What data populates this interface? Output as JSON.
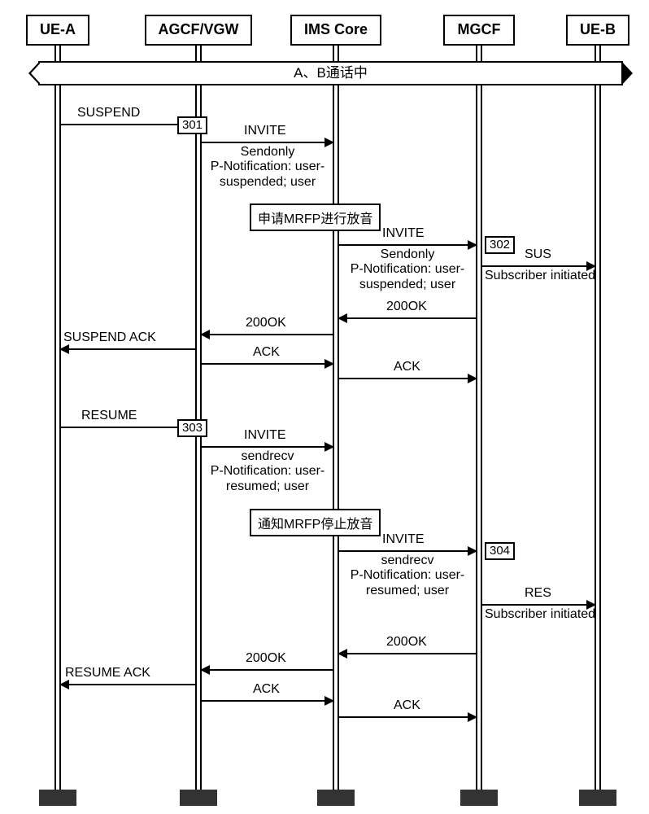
{
  "participants": {
    "uea": "UE-A",
    "agcf": "AGCF/VGW",
    "ims": "IMS Core",
    "mgcf": "MGCF",
    "ueb": "UE-B"
  },
  "state_bar": "A、B通话中",
  "steps": {
    "s301": "301",
    "s302": "302",
    "s303": "303",
    "s304": "304"
  },
  "notes": {
    "mrfp_start": "申请MRFP进行放音",
    "mrfp_stop": "通知MRFP停止放音"
  },
  "messages": {
    "suspend": "SUSPEND",
    "invite": "INVITE",
    "sendonly": "Sendonly",
    "pnotif_susp1": "P-Notification: user-",
    "pnotif_susp2": "suspended; user",
    "sus": "SUS",
    "sub_init": "Subscriber initiated",
    "ok200": "200OK",
    "suspend_ack": "SUSPEND ACK",
    "ack": "ACK",
    "resume": "RESUME",
    "sendrecv": "sendrecv",
    "pnotif_res1": "P-Notification: user-",
    "pnotif_res2": "resumed; user",
    "res": "RES",
    "resume_ack": "RESUME ACK"
  },
  "chart_data": {
    "type": "sequence",
    "participants": [
      "UE-A",
      "AGCF/VGW",
      "IMS Core",
      "MGCF",
      "UE-B"
    ],
    "state": "A、B通话中",
    "events": [
      {
        "from": "UE-A",
        "to": "AGCF/VGW",
        "label": "SUSPEND"
      },
      {
        "step": "301",
        "at": "AGCF/VGW"
      },
      {
        "from": "AGCF/VGW",
        "to": "IMS Core",
        "label": "INVITE",
        "sub": [
          "Sendonly",
          "P-Notification: user-suspended; user"
        ]
      },
      {
        "note": "申请MRFP进行放音",
        "at": "IMS Core"
      },
      {
        "from": "IMS Core",
        "to": "MGCF",
        "label": "INVITE",
        "sub": [
          "Sendonly",
          "P-Notification: user-suspended; user"
        ]
      },
      {
        "step": "302",
        "at": "MGCF"
      },
      {
        "from": "MGCF",
        "to": "UE-B",
        "label": "SUS",
        "sub": [
          "Subscriber initiated"
        ]
      },
      {
        "from": "MGCF",
        "to": "IMS Core",
        "label": "200OK"
      },
      {
        "from": "IMS Core",
        "to": "AGCF/VGW",
        "label": "200OK"
      },
      {
        "from": "AGCF/VGW",
        "to": "UE-A",
        "label": "SUSPEND ACK"
      },
      {
        "from": "AGCF/VGW",
        "to": "IMS Core",
        "label": "ACK"
      },
      {
        "from": "IMS Core",
        "to": "MGCF",
        "label": "ACK"
      },
      {
        "from": "UE-A",
        "to": "AGCF/VGW",
        "label": "RESUME"
      },
      {
        "step": "303",
        "at": "AGCF/VGW"
      },
      {
        "from": "AGCF/VGW",
        "to": "IMS Core",
        "label": "INVITE",
        "sub": [
          "sendrecv",
          "P-Notification: user-resumed; user"
        ]
      },
      {
        "note": "通知MRFP停止放音",
        "at": "IMS Core"
      },
      {
        "from": "IMS Core",
        "to": "MGCF",
        "label": "INVITE",
        "sub": [
          "sendrecv",
          "P-Notification: user-resumed; user"
        ]
      },
      {
        "step": "304",
        "at": "MGCF"
      },
      {
        "from": "MGCF",
        "to": "UE-B",
        "label": "RES",
        "sub": [
          "Subscriber initiated"
        ]
      },
      {
        "from": "MGCF",
        "to": "IMS Core",
        "label": "200OK"
      },
      {
        "from": "IMS Core",
        "to": "AGCF/VGW",
        "label": "200OK"
      },
      {
        "from": "AGCF/VGW",
        "to": "UE-A",
        "label": "RESUME ACK"
      },
      {
        "from": "AGCF/VGW",
        "to": "IMS Core",
        "label": "ACK"
      },
      {
        "from": "IMS Core",
        "to": "MGCF",
        "label": "ACK"
      }
    ]
  }
}
